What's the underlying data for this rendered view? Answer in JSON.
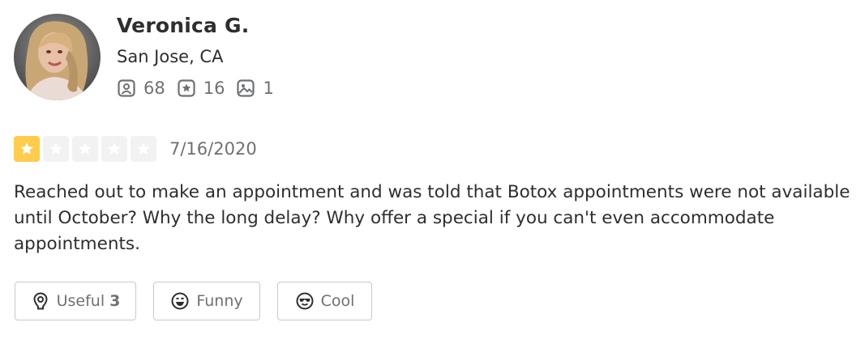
{
  "user": {
    "name": "Veronica G.",
    "location": "San Jose, CA",
    "stats": {
      "friends": "68",
      "reviews": "16",
      "photos": "1"
    },
    "stat_icons": [
      "friends-icon",
      "reviews-icon",
      "photos-icon"
    ]
  },
  "review": {
    "rating": 1,
    "rating_max": 5,
    "date": "7/16/2020",
    "text": "Reached out to make an appointment and was told that Botox appointments were not available until October? Why the long delay? Why offer a special if you can't even accommodate appointments."
  },
  "actions": {
    "useful_label": "Useful",
    "useful_count": "3",
    "funny_label": "Funny",
    "cool_label": "Cool"
  },
  "colors": {
    "star_filled": "#ffcc4b",
    "star_empty": "#f2f2f2",
    "text_primary": "#2d2e2f",
    "text_secondary": "#6e7072",
    "button_border": "#c8c9ca"
  }
}
